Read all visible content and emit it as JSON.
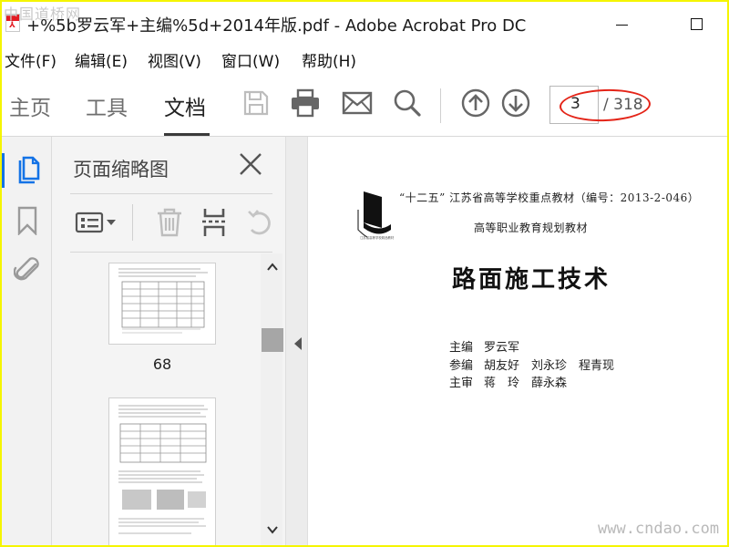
{
  "watermark_top": "中国道桥网",
  "watermark_bottom": "www.cndao.com",
  "window": {
    "title": "+%5b罗云军+主编%5d+2014年版.pdf - Adobe Acrobat Pro DC"
  },
  "menu": [
    "文件(F)",
    "编辑(E)",
    "视图(V)",
    "窗口(W)",
    "帮助(H)"
  ],
  "nav_tabs": {
    "home": "主页",
    "tools": "工具",
    "document": "文档"
  },
  "page_nav": {
    "current": "3",
    "total": "/ 318"
  },
  "panel": {
    "title": "页面缩略图",
    "thumbnails": [
      {
        "label": "68"
      },
      {
        "label": ""
      }
    ]
  },
  "document": {
    "series": "“十二五” 江苏省高等学校重点教材（编号：2013-2-046）",
    "subtitle": "高等职业教育规划教材",
    "title": "路面施工技术",
    "credits": [
      {
        "role": "主编",
        "names": "罗云军"
      },
      {
        "role": "参编",
        "names": "胡友好　刘永珍　程青现"
      },
      {
        "role": "主审",
        "names": "蒋　玲　薛永森"
      }
    ]
  },
  "colors": {
    "active_blue": "#1473e6",
    "annotation_red": "#e42418",
    "background_frame": "#f5f500"
  }
}
